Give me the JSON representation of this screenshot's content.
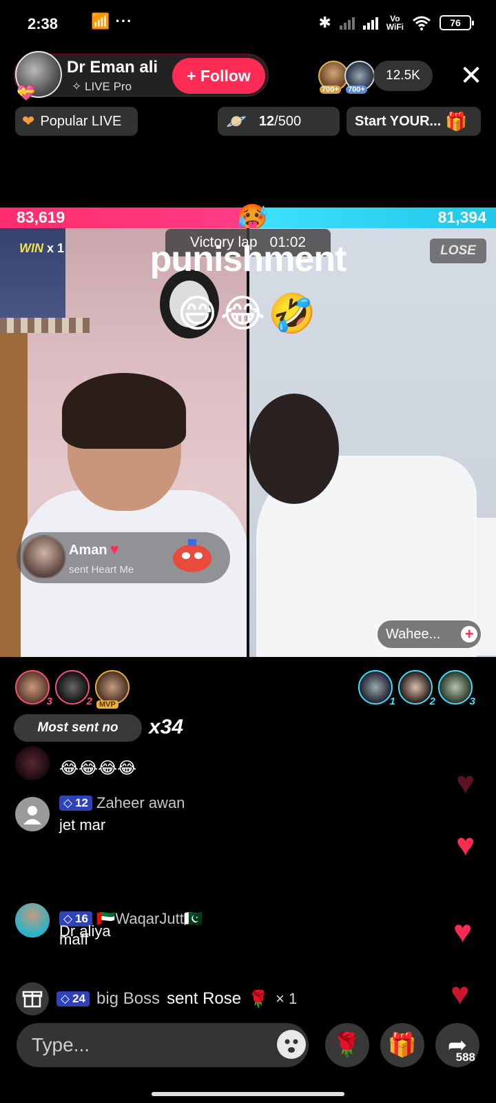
{
  "status": {
    "time": "2:38",
    "network_label": "Vo\nWiFi",
    "battery": "76"
  },
  "header": {
    "host_name": "Dr Eman ali",
    "host_sub": "LIVE Pro",
    "follow_label": "+ Follow",
    "viewer_badges": [
      "700+",
      "700+"
    ],
    "viewer_count": "12.5K",
    "close_icon": "close-icon"
  },
  "pills": {
    "popular": "Popular LIVE",
    "goal_current": "12",
    "goal_total": "/500",
    "start": "Start YOUR..."
  },
  "battle": {
    "score_left": "83,619",
    "score_right": "81,394",
    "win_label": "WIN",
    "win_count": "x 1",
    "lose_label": "LOSE",
    "victory_label": "Victory lap",
    "victory_time": "01:02",
    "overlay_text": "punishment",
    "overlay_emojis": "😅😂🤣",
    "accent_left": "#ff2d6c",
    "accent_right": "#3ee1ff"
  },
  "gift_toast": {
    "name": "Aman",
    "text": "sent Heart Me"
  },
  "guest": {
    "name": "Wahee..."
  },
  "ranks": {
    "left": [
      "3",
      "2",
      "MVP"
    ],
    "right": [
      "1",
      "2",
      "3"
    ]
  },
  "most_sent": {
    "label": "Most sent no",
    "count": "x34"
  },
  "chat": [
    {
      "name": "",
      "level": "",
      "msg": "😂😂😂😂"
    },
    {
      "name": "Zaheer awan",
      "level": "12",
      "msg": "jet mar"
    },
    {
      "name": "🇦🇪WaqarJutt🇵🇰",
      "level": "16",
      "msg": "maff"
    },
    {
      "name": "",
      "level": "",
      "msg": "Dr aliya"
    }
  ],
  "gift_line": {
    "level": "24",
    "name": "big Boss",
    "text": "sent Rose",
    "gift": "🌹",
    "count": "× 1"
  },
  "bottom": {
    "placeholder": "Type...",
    "share_count": "588"
  }
}
